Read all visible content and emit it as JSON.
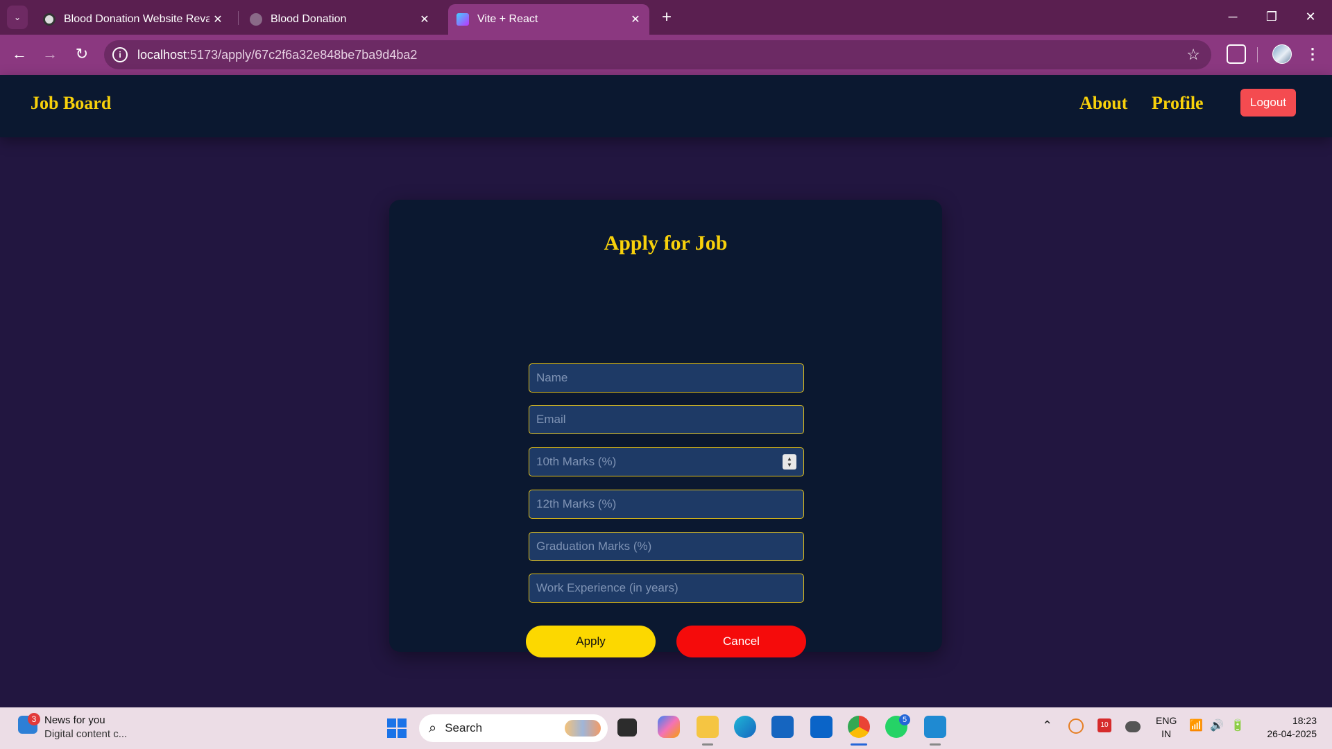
{
  "browser": {
    "tabs": [
      {
        "title": "Blood Donation Website Revamp",
        "active": false
      },
      {
        "title": "Blood Donation",
        "active": false
      },
      {
        "title": "Vite + React",
        "active": true
      }
    ],
    "close_glyph": "✕",
    "new_tab_glyph": "+",
    "url_host": "localhost",
    "url_path": ":5173/apply/67c2f6a32e848be7ba9d4ba2",
    "window_controls": {
      "minimize": "─",
      "restore": "❐",
      "close": "✕"
    },
    "nav_glyphs": {
      "back": "←",
      "forward": "→",
      "reload": "↻",
      "star": "☆",
      "menu": "⋮",
      "info": "i",
      "tab_menu": "⌄"
    }
  },
  "app": {
    "brand": "Job Board",
    "nav_links": [
      "About",
      "Profile"
    ],
    "logout_label": "Logout"
  },
  "form": {
    "title": "Apply for Job",
    "fields": [
      {
        "placeholder": "Name",
        "type": "text"
      },
      {
        "placeholder": "Email",
        "type": "email"
      },
      {
        "placeholder": "10th Marks (%)",
        "type": "number"
      },
      {
        "placeholder": "12th Marks (%)",
        "type": "number"
      },
      {
        "placeholder": "Graduation Marks (%)",
        "type": "number"
      },
      {
        "placeholder": "Work Experience (in years)",
        "type": "number"
      }
    ],
    "apply_label": "Apply",
    "cancel_label": "Cancel",
    "spinner_up": "▲",
    "spinner_down": "▼"
  },
  "taskbar": {
    "news_title": "News for you",
    "news_subtitle": "Digital content c...",
    "news_badge": "3",
    "search_label": "Search",
    "search_glyph": "⌕",
    "whatsapp_badge": "5",
    "calendar_badge": "10",
    "tray_chevron": "⌃",
    "lang_line1": "ENG",
    "lang_line2": "IN",
    "time": "18:23",
    "date": "26-04-2025",
    "wifi_glyph": "📶",
    "volume_glyph": "🔊",
    "battery_glyph": "🔋"
  },
  "colors": {
    "page_bg": "#221640",
    "nav_bg": "#0b1830",
    "accent_yellow": "#f8d10b",
    "logout_red": "#f44b50",
    "cancel_red": "#f50b0b",
    "field_bg": "#1e3a66"
  }
}
